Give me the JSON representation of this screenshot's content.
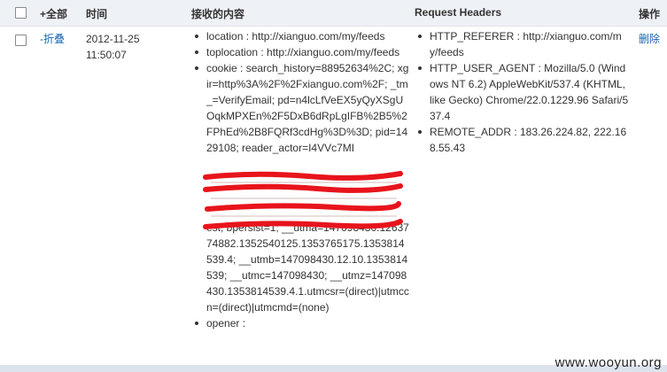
{
  "header": {
    "select_all": "+全部",
    "time": "时间",
    "content": "接收的内容",
    "request_headers": "Request Headers",
    "action": "操作"
  },
  "row": {
    "collapse": "-折叠",
    "date": "2012-11-25",
    "time": "11:50:07",
    "content_items": [
      "location : http://xianguo.com/my/feeds",
      "toplocation : http://xianguo.com/my/feeds",
      "cookie : search_history=88952634%2C; xgir=http%3A%2F%2Fxianguo.com%2F; _tm_=VerifyEmail; pd=n4lcLfVeEX5yQyXSgUOqkMPXEn%2F5DxB6dRpLgIFB%2B5%2FPhEd%2B8FQRf3cdHg%3D%3D; pid=1429108; reader_actor=I4VVc7MI",
      "est; bpersist=1; __utma=147098430.1263774882.1352540125.1353765175.1353814539.4; __utmb=147098430.12.10.1353814539; __utmc=147098430; __utmz=147098430.1353814539.4.1.utmcsr=(direct)|utmccn=(direct)|utmcmd=(none)",
      "opener :"
    ],
    "header_items": [
      "HTTP_REFERER : http://xianguo.com/my/feeds",
      "HTTP_USER_AGENT : Mozilla/5.0 (Windows NT 6.2) AppleWebKit/537.4 (KHTML, like Gecko) Chrome/22.0.1229.96 Safari/537.4",
      "REMOTE_ADDR : 183.26.224.82, 222.168.55.43"
    ],
    "delete": "删除"
  },
  "watermark": "www.wooyun.org",
  "colors": {
    "header_bg": "#eef1f6",
    "link": "#1a64b8",
    "redaction": "#e8141c"
  }
}
